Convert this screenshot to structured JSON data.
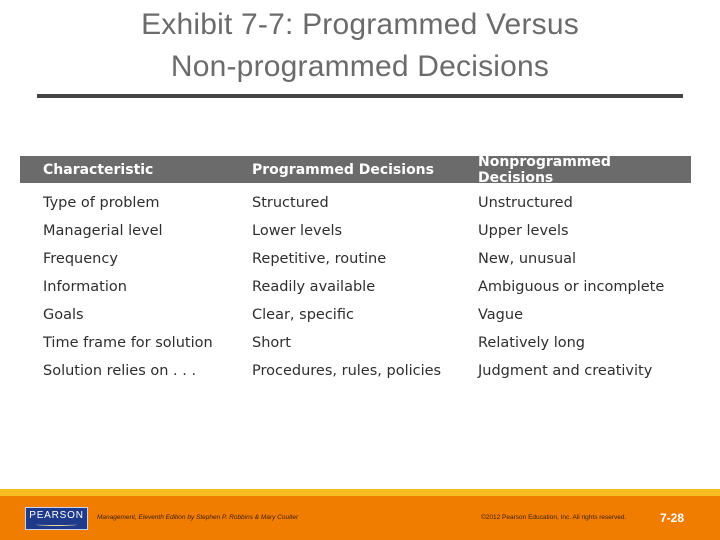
{
  "slide": {
    "title_line1": "Exhibit 7-7: Programmed Versus",
    "title_line2": "Non-programmed Decisions"
  },
  "table": {
    "headers": [
      "Characteristic",
      "Programmed Decisions",
      "Nonprogrammed Decisions"
    ],
    "rows": [
      [
        "Type of problem",
        "Structured",
        "Unstructured"
      ],
      [
        "Managerial level",
        "Lower levels",
        "Upper levels"
      ],
      [
        "Frequency",
        "Repetitive, routine",
        "New, unusual"
      ],
      [
        "Information",
        "Readily available",
        "Ambiguous or incomplete"
      ],
      [
        "Goals",
        "Clear, specific",
        "Vague"
      ],
      [
        "Time frame for solution",
        "Short",
        "Relatively long"
      ],
      [
        "Solution relies on . . .",
        "Procedures, rules, policies",
        "Judgment and creativity"
      ]
    ]
  },
  "footer": {
    "logo_text": "PEARSON",
    "credit": "Management, Eleventh Edition by Stephen P. Robbins & Mary Coulter",
    "copyright": "©2012 Pearson Education, Inc.  All rights reserved.",
    "page_number": "7-28",
    "colors": {
      "yellow_band": "#f5bd1f",
      "orange_band": "#f07d00",
      "logo_bg": "#1f3a8a",
      "header_bg": "#6b6b6b"
    }
  }
}
